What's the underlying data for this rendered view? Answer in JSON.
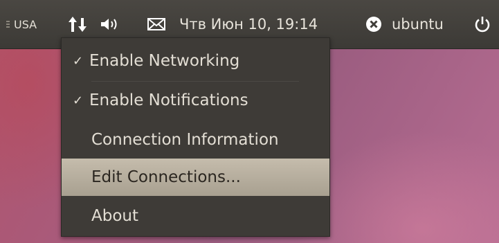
{
  "panel": {
    "keyboard_layout": "USA",
    "clock": "Чтв Июн 10, 19:14",
    "username": "ubuntu",
    "icons": [
      "network-icon",
      "volume-icon",
      "mail-icon",
      "user-status-icon",
      "power-icon"
    ]
  },
  "menu": {
    "items": [
      {
        "label": "Enable Networking",
        "checked": true
      },
      {
        "label": "Enable Notifications",
        "checked": true
      },
      {
        "label": "Connection Information",
        "checked": false
      },
      {
        "label": "Edit Connections...",
        "checked": false,
        "highlighted": true
      },
      {
        "label": "About",
        "checked": false
      }
    ],
    "check_glyph": "✓"
  },
  "colors": {
    "panel_bg": "#3f3d39",
    "menu_bg": "#3e3b37",
    "highlight": "#b8b0a0",
    "desktop": "#a95a7a"
  }
}
